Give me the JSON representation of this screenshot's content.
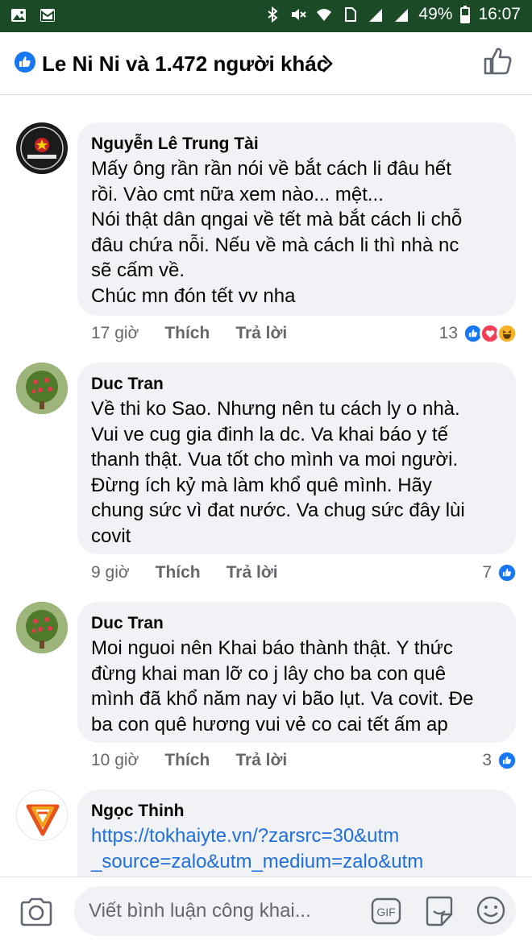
{
  "status_bar": {
    "battery": "49%",
    "time": "16:07",
    "icons": [
      "gallery-icon",
      "mail-icon",
      "bluetooth-icon",
      "mute-icon",
      "wifi-icon",
      "sim-icon",
      "signal-icon",
      "signal-icon",
      "battery-icon"
    ]
  },
  "header": {
    "title": "Le Ni Ni và 1.472 người khác",
    "icons": [
      "like-reaction-icon",
      "chevron-right-icon",
      "thumbs-up-icon"
    ]
  },
  "comments": [
    {
      "author": "Nguyễn Lê Trung Tài",
      "lines": [
        "Mấy ông rần rần nói về bắt cách li đâu hết",
        "rồi. Vào cmt nữa xem nào... mệt...",
        "Nói thật dân qngai về tết mà bắt cách li chỗ",
        "đâu chứa nỗi. Nếu về mà cách li thì nhà nc",
        "sẽ cấm về.",
        "Chúc mn đón tết vv nha"
      ],
      "time": "17 giờ",
      "like_label": "Thích",
      "reply_label": "Trả lời",
      "reaction_count": "13",
      "reactions": [
        "like",
        "love",
        "haha"
      ]
    },
    {
      "author": "Duc Tran",
      "lines": [
        "Về thi ko Sao. Nhưng nên tu cách ly o nhà.",
        "Vui ve cug gia đinh la dc. Va khai báo  y tế",
        "thanh thật. Vua tốt cho mình va moi người.",
        "Đừng ích kỷ  mà làm  khổ  quê mình. Hãy",
        "chung sức vì đat nước. Va chug sức đây lùi",
        "covit"
      ],
      "time": "9 giờ",
      "like_label": "Thích",
      "reply_label": "Trả lời",
      "reaction_count": "7",
      "reactions": [
        "like"
      ]
    },
    {
      "author": "Duc Tran",
      "lines": [
        "Moi nguoi nên Khai báo thành thật. Y thức",
        "đừng khai man lỡ co j lây cho ba con quê",
        "mình  đã khổ năm nay vi bão lụt. Va covit. Đe",
        "ba con quê hương vui vẻ co cai tết ấm ap"
      ],
      "time": "10 giờ",
      "like_label": "Thích",
      "reply_label": "Trả lời",
      "reaction_count": "3",
      "reactions": [
        "like"
      ]
    },
    {
      "author": "Ngọc Thinh",
      "lines": [
        "https://tokhaiyte.vn/?zarsrc=30&utm",
        "_source=zalo&utm_medium=zalo&utm"
      ]
    }
  ],
  "composer": {
    "placeholder": "Viết bình luận công khai...",
    "gif_label": "GIF",
    "icons": [
      "camera-icon",
      "gif-icon",
      "sticker-icon",
      "emoji-icon"
    ]
  },
  "colors": {
    "status_bar": "#1a4a26",
    "like_blue": "#1877f2",
    "love_red": "#f33e58",
    "haha_yellow": "#f7b125",
    "bubble_bg": "#f0f2f5",
    "link_blue": "#216fdb",
    "meta_gray": "#65676b"
  }
}
